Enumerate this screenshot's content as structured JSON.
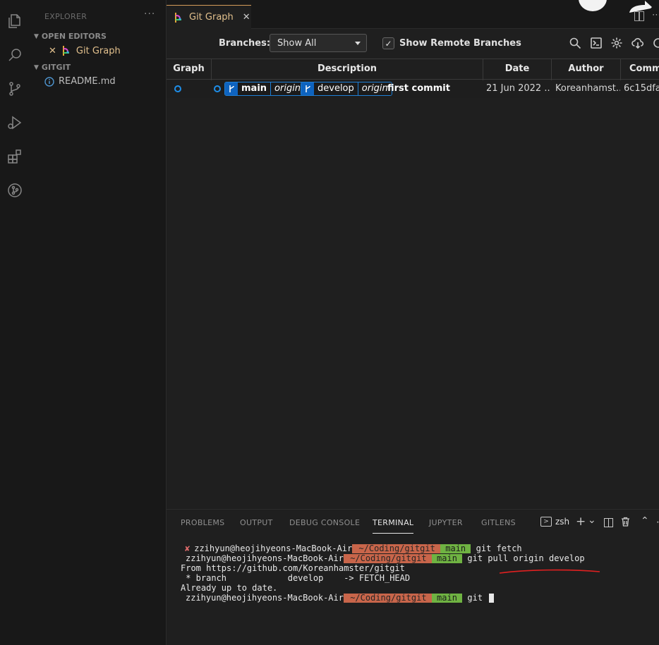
{
  "sidebar": {
    "header": "EXPLORER",
    "more": "···",
    "sections": [
      {
        "label": "OPEN EDITORS"
      },
      {
        "label": "GITGIT"
      }
    ],
    "open_editor": {
      "close": "✕",
      "label": "Git Graph"
    },
    "files": [
      {
        "label": "README.md"
      }
    ]
  },
  "tab": {
    "label": "Git Graph",
    "close": "✕"
  },
  "controls": {
    "branches_label": "Branches:",
    "branches_value": "Show All",
    "remote_checked": "✓",
    "remote_label": "Show Remote Branches"
  },
  "table": {
    "headers": [
      "Graph",
      "Description",
      "Date",
      "Author",
      "Comm"
    ],
    "row": {
      "refs": [
        {
          "name": "main",
          "remote": "origin"
        },
        {
          "name": "develop",
          "remote": "origin"
        }
      ],
      "message": "first commit",
      "date": "21 Jun 2022 ...",
      "author": "Koreanhamst...",
      "commit": "6c15dfa"
    }
  },
  "panel": {
    "tabs": [
      "PROBLEMS",
      "OUTPUT",
      "DEBUG CONSOLE",
      "TERMINAL",
      "JUPYTER",
      "GITLENS"
    ],
    "active_tab": "TERMINAL",
    "shell": "zsh",
    "plus": "+",
    "chevron": "⌄",
    "trash": "🗑",
    "up": "⌃",
    "more": "⋯"
  },
  "terminal": {
    "fail_mark": "✘",
    "user": "zzihyun@heojihyeons-MacBook-Air",
    "path": " ~/Coding/gitgit ",
    "branch": " main ",
    "cmd1": " git fetch",
    "cmd2": " git pull origin develop",
    "out1": "From https://github.com/Koreanhamster/gitgit",
    "out2": " * branch            develop    -> FETCH_HEAD",
    "out3": "Already up to date.",
    "cmd3": " git "
  },
  "colors": {
    "accent_tab": "#d49b5a",
    "ref_blue": "#0e63bf",
    "prompt_path": "#c8654a",
    "prompt_branch": "#6fb342",
    "annotation_red": "#e02020"
  }
}
